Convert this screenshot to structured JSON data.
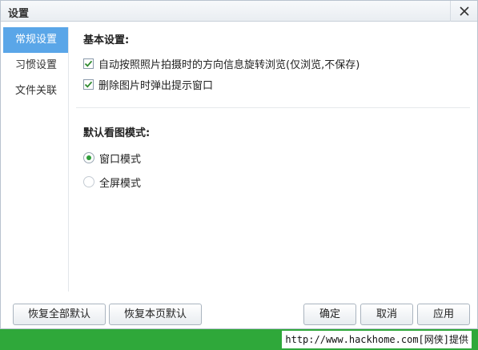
{
  "window": {
    "title": "设置"
  },
  "sidebar": {
    "items": [
      {
        "label": "常规设置",
        "active": true
      },
      {
        "label": "习惯设置",
        "active": false
      },
      {
        "label": "文件关联",
        "active": false
      }
    ]
  },
  "basic": {
    "title": "基本设置:",
    "options": [
      {
        "label": "自动按照照片拍摄时的方向信息旋转浏览(仅浏览,不保存)",
        "checked": true
      },
      {
        "label": "删除图片时弹出提示窗口",
        "checked": true
      }
    ]
  },
  "view_mode": {
    "title": "默认看图模式:",
    "options": [
      {
        "label": "窗口模式",
        "selected": true
      },
      {
        "label": "全屏模式",
        "selected": false
      }
    ]
  },
  "buttons": {
    "restore_all": "恢复全部默认",
    "restore_page": "恢复本页默认",
    "ok": "确定",
    "cancel": "取消",
    "apply": "应用"
  },
  "footer": {
    "text": "http://www.hackhome.com[网侠]提供"
  },
  "colors": {
    "accent": "#5aa6e8",
    "radio": "#2f9e3a",
    "footer_bar": "#2fa83a"
  }
}
